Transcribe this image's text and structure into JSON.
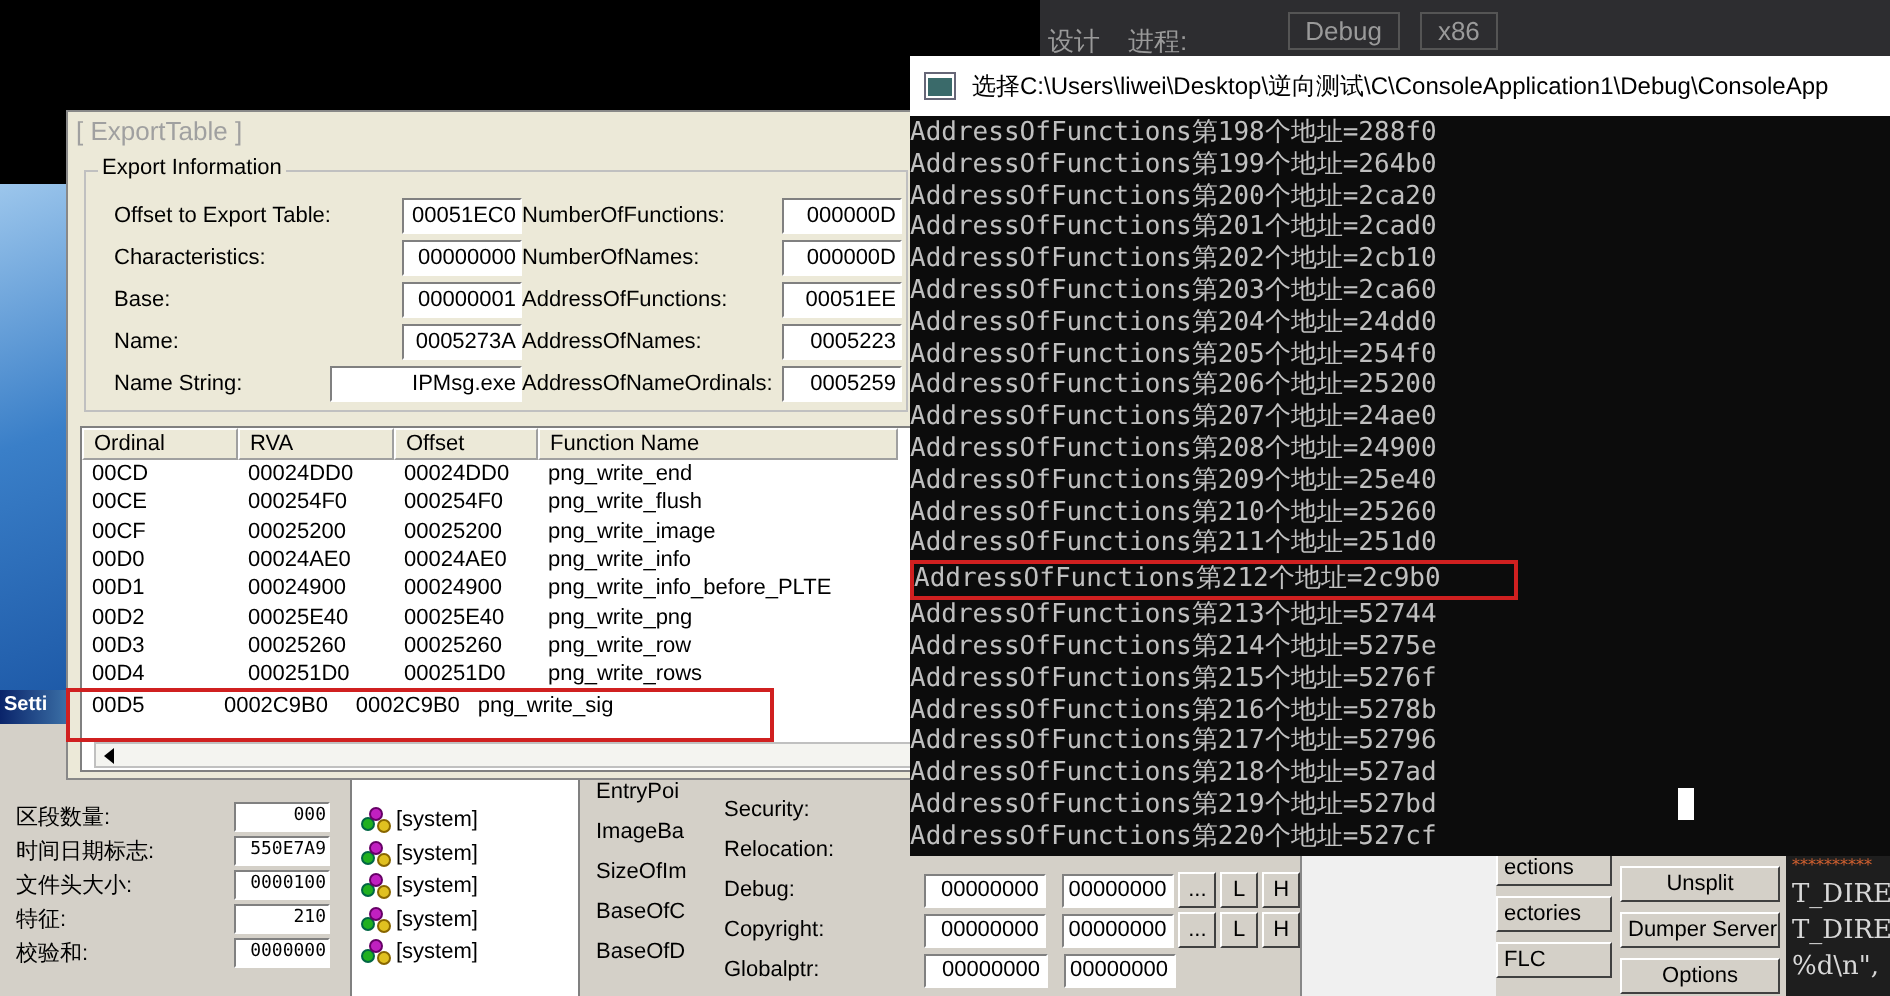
{
  "ide_toolbar": {
    "menu_fragment": "设计",
    "process_label": "进程:",
    "configuration": "Debug",
    "platform": "x86"
  },
  "desktop_window": {
    "title": "Setti"
  },
  "pe_editor": {
    "header_fields": [
      {
        "label": "区段数量:",
        "value": "000"
      },
      {
        "label": "时间日期标志:",
        "value": "550E7A9"
      },
      {
        "label": "文件头大小:",
        "value": "0000100"
      },
      {
        "label": "特征:",
        "value": "210"
      },
      {
        "label": "校验和:",
        "value": "0000000"
      }
    ],
    "processes": [
      {
        "name": "[system]"
      },
      {
        "name": "[system]"
      },
      {
        "name": "[system]"
      },
      {
        "name": "[system]"
      },
      {
        "name": "[system]"
      }
    ],
    "optional_labels": [
      "EntryPoi",
      "ImageBa",
      "SizeOfIm",
      "BaseOfC",
      "BaseOfD"
    ],
    "directories": [
      {
        "label": "Security:"
      },
      {
        "label": "Relocation:"
      },
      {
        "label": "Debug:",
        "values": [
          "00000000",
          "00000000"
        ],
        "buttons": [
          "...",
          "L",
          "H"
        ]
      },
      {
        "label": "Copyright:",
        "values": [
          "00000000",
          "00000000"
        ],
        "buttons": [
          "...",
          "L",
          "H"
        ]
      },
      {
        "label": "Globalptr:",
        "values": [
          "00000000",
          "00000000"
        ]
      }
    ],
    "side_buttons": [
      "ections",
      "ectories",
      "FLC"
    ],
    "main_buttons": [
      "Unsplit",
      "Dumper Server",
      "Options"
    ],
    "code_lines": [
      "**********",
      "T_DIRE",
      "T_DIRE",
      "%d\\n\","
    ]
  },
  "export_table": {
    "title": "[ ExportTable ]",
    "group_title": "Export Information",
    "left_fields": [
      {
        "label": "Offset to Export Table:",
        "value": "00051EC0"
      },
      {
        "label": "Characteristics:",
        "value": "00000000"
      },
      {
        "label": "Base:",
        "value": "00000001"
      },
      {
        "label": "Name:",
        "value": "0005273A"
      },
      {
        "label": "Name String:",
        "value": "IPMsg.exe"
      }
    ],
    "right_fields": [
      {
        "label": "NumberOfFunctions:",
        "value": "000000D"
      },
      {
        "label": "NumberOfNames:",
        "value": "000000D"
      },
      {
        "label": "AddressOfFunctions:",
        "value": "00051EE"
      },
      {
        "label": "AddressOfNames:",
        "value": "0005223"
      },
      {
        "label": "AddressOfNameOrdinals:",
        "value": "0005259"
      }
    ],
    "columns": [
      "Ordinal",
      "RVA",
      "Offset",
      "Function Name"
    ],
    "rows": [
      {
        "cells": [
          "00CD",
          "00024DD0",
          "00024DD0",
          "png_write_end"
        ],
        "highlighted": false
      },
      {
        "cells": [
          "00CE",
          "000254F0",
          "000254F0",
          "png_write_flush"
        ],
        "highlighted": false
      },
      {
        "cells": [
          "00CF",
          "00025200",
          "00025200",
          "png_write_image"
        ],
        "highlighted": false
      },
      {
        "cells": [
          "00D0",
          "00024AE0",
          "00024AE0",
          "png_write_info"
        ],
        "highlighted": false
      },
      {
        "cells": [
          "00D1",
          "00024900",
          "00024900",
          "png_write_info_before_PLTE"
        ],
        "highlighted": false
      },
      {
        "cells": [
          "00D2",
          "00025E40",
          "00025E40",
          "png_write_png"
        ],
        "highlighted": false
      },
      {
        "cells": [
          "00D3",
          "00025260",
          "00025260",
          "png_write_row"
        ],
        "highlighted": false
      },
      {
        "cells": [
          "00D4",
          "000251D0",
          "000251D0",
          "png_write_rows"
        ],
        "highlighted": false
      },
      {
        "cells": [
          "00D5",
          "0002C9B0",
          "0002C9B0",
          "png_write_sig"
        ],
        "highlighted": true
      }
    ]
  },
  "console": {
    "title": "选择C:\\Users\\liwei\\Desktop\\逆向测试\\C\\ConsoleApplication1\\Debug\\ConsoleApp",
    "lines": [
      {
        "text": "AddressOfFunctions第198个地址=288f0",
        "highlighted": false
      },
      {
        "text": "AddressOfFunctions第199个地址=264b0",
        "highlighted": false
      },
      {
        "text": "AddressOfFunctions第200个地址=2ca20",
        "highlighted": false
      },
      {
        "text": "AddressOfFunctions第201个地址=2cad0",
        "highlighted": false
      },
      {
        "text": "AddressOfFunctions第202个地址=2cb10",
        "highlighted": false
      },
      {
        "text": "AddressOfFunctions第203个地址=2ca60",
        "highlighted": false
      },
      {
        "text": "AddressOfFunctions第204个地址=24dd0",
        "highlighted": false
      },
      {
        "text": "AddressOfFunctions第205个地址=254f0",
        "highlighted": false
      },
      {
        "text": "AddressOfFunctions第206个地址=25200",
        "highlighted": false
      },
      {
        "text": "AddressOfFunctions第207个地址=24ae0",
        "highlighted": false
      },
      {
        "text": "AddressOfFunctions第208个地址=24900",
        "highlighted": false
      },
      {
        "text": "AddressOfFunctions第209个地址=25e40",
        "highlighted": false
      },
      {
        "text": "AddressOfFunctions第210个地址=25260",
        "highlighted": false
      },
      {
        "text": "AddressOfFunctions第211个地址=251d0",
        "highlighted": false
      },
      {
        "text": "AddressOfFunctions第212个地址=2c9b0",
        "highlighted": true
      },
      {
        "text": "AddressOfFunctions第213个地址=52744",
        "highlighted": false
      },
      {
        "text": "AddressOfFunctions第214个地址=5275e",
        "highlighted": false
      },
      {
        "text": "AddressOfFunctions第215个地址=5276f",
        "highlighted": false
      },
      {
        "text": "AddressOfFunctions第216个地址=5278b",
        "highlighted": false
      },
      {
        "text": "AddressOfFunctions第217个地址=52796",
        "highlighted": false
      },
      {
        "text": "AddressOfFunctions第218个地址=527ad",
        "highlighted": false
      },
      {
        "text": "AddressOfFunctions第219个地址=527bd",
        "highlighted": false
      },
      {
        "text": "AddressOfFunctions第220个地址=527cf",
        "highlighted": false
      }
    ]
  }
}
